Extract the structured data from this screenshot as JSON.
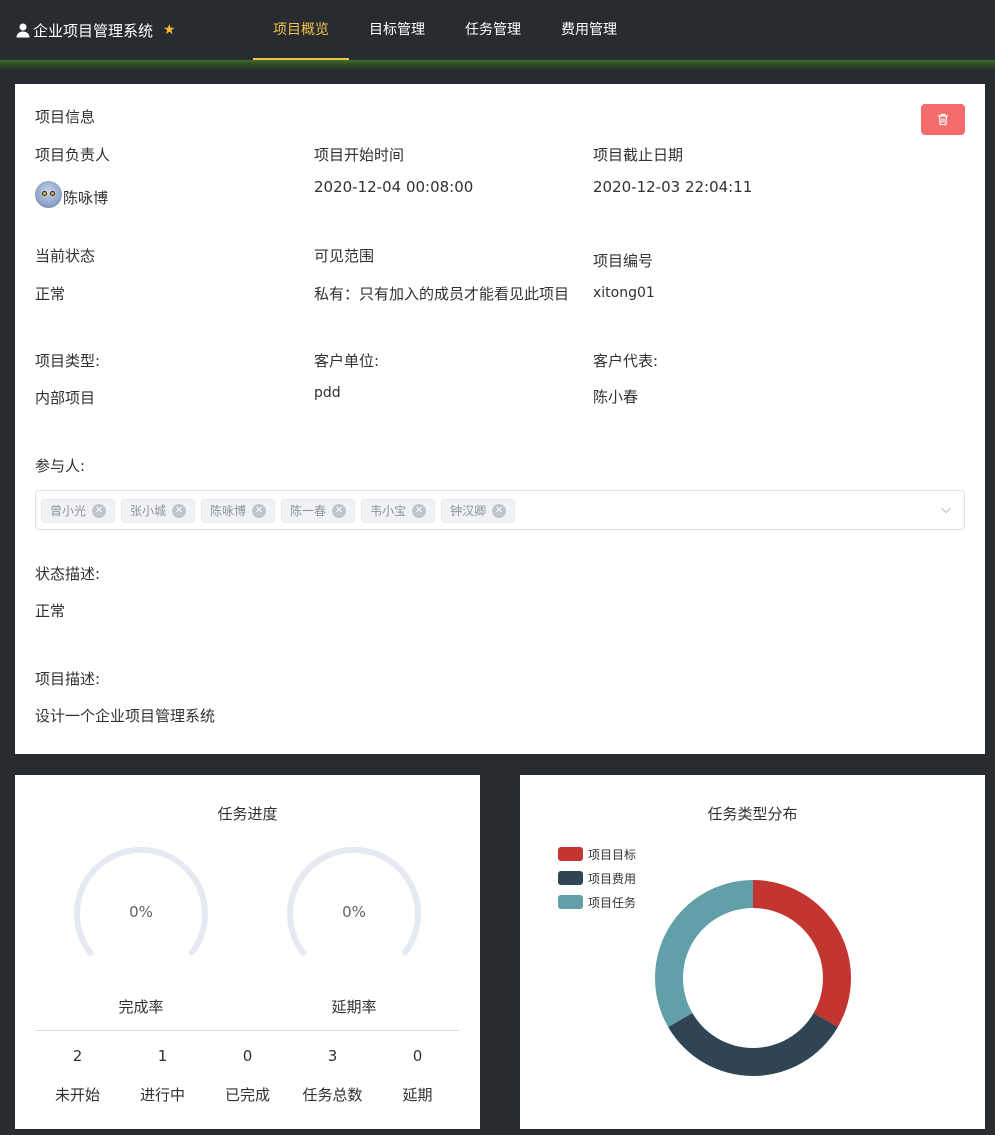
{
  "header": {
    "app_title": "企业项目管理系统",
    "user_icon": "user-icon",
    "star_icon": "star-icon",
    "tabs": [
      {
        "label": "项目概览",
        "active": true
      },
      {
        "label": "目标管理",
        "active": false
      },
      {
        "label": "任务管理",
        "active": false
      },
      {
        "label": "费用管理",
        "active": false
      }
    ],
    "active_color": "#f0c248"
  },
  "project": {
    "section_title": "项目信息",
    "delete_icon": "trash-icon",
    "owner_label": "项目负责人",
    "owner_name": "陈咏博",
    "start_label": "项目开始时间",
    "start_value": "2020-12-04 00:08:00",
    "deadline_label": "项目截止日期",
    "deadline_value": "2020-12-03 22:04:11",
    "status_label": "当前状态",
    "status_value": "正常",
    "visibility_label": "可见范围",
    "visibility_value": "私有：只有加入的成员才能看见此项目",
    "code_label": "项目编号",
    "code_value": "xitong01",
    "type_label": "项目类型:",
    "type_value": "内部项目",
    "client_label": "客户单位:",
    "client_value": "pdd",
    "client_rep_label": "客户代表:",
    "client_rep_value": "陈小春",
    "participants_label": "参与人:",
    "participants": [
      "曾小光",
      "张小城",
      "陈咏博",
      "陈一春",
      "韦小宝",
      "钟汉卿"
    ],
    "status_desc_label": "状态描述:",
    "status_desc_value": "正常",
    "desc_label": "项目描述:",
    "desc_value": "设计一个企业项目管理系统",
    "delete_color": "#f56c6c"
  },
  "progress": {
    "title": "任务进度",
    "completion_rate": "0%",
    "completion_label": "完成率",
    "delay_rate": "0%",
    "delay_label": "延期率",
    "stats": [
      {
        "value": "2",
        "label": "未开始"
      },
      {
        "value": "1",
        "label": "进行中"
      },
      {
        "value": "0",
        "label": "已完成"
      },
      {
        "value": "3",
        "label": "任务总数"
      },
      {
        "value": "0",
        "label": "延期"
      }
    ]
  },
  "chart_data": {
    "type": "pie",
    "title": "任务类型分布",
    "categories": [
      "项目目标",
      "项目费用",
      "项目任务"
    ],
    "values": [
      1,
      1,
      1
    ],
    "colors": [
      "#c23531",
      "#2f4554",
      "#61a0a8"
    ],
    "legend": "top-left",
    "donut": true
  }
}
